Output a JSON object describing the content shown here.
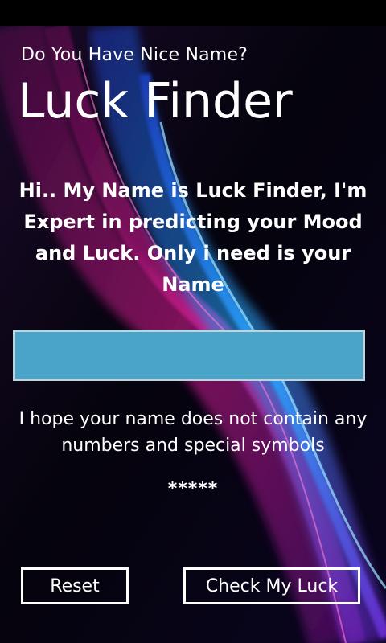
{
  "header": {
    "subtitle": "Do You Have Nice Name?",
    "title": "Luck Finder"
  },
  "intro_text": "Hi.. My Name is Luck Finder, I'm Expert in predicting your Mood and  Luck. Only i need is your Name",
  "name_input": {
    "value": "",
    "placeholder": ""
  },
  "hint_text": "I hope your name does not contain any numbers and special symbols",
  "result_text": "*****",
  "buttons": {
    "reset_label": "Reset",
    "check_label": "Check My Luck"
  },
  "colors": {
    "background": "#000000",
    "input_fill": "#4aa3c8",
    "text": "#ffffff",
    "wave_blue": "#2aa9ff",
    "wave_magenta": "#e0209a"
  }
}
